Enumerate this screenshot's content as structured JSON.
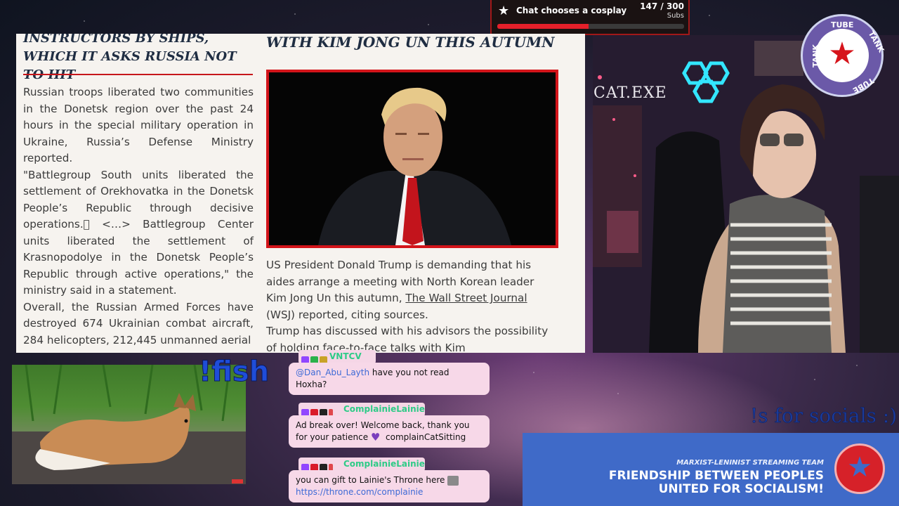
{
  "goal": {
    "title": "Chat chooses a cosplay",
    "count": "147 / 300",
    "unit": "Subs",
    "progress": 0.49,
    "accent": "#e4202a"
  },
  "article": {
    "left_headline": "INSTRUCTORS BY SHIPS, WHICH IT ASKS RUSSIA NOT TO HIT",
    "right_headline": "WITH KIM JONG UN THIS AUTUMN",
    "left_paragraphs": [
      "Russian troops liberated two communities in the Donetsk region over the past 24 hours in the special military operation in Ukraine, Russia’s Defense Ministry reported.",
      "\"Battlegroup South units liberated the settlement of Orekhovatka in the Donetsk People’s Republic through decisive operations.\u0000 <…> Battlegroup Center units liberated the settlement of Krasnopodolye in the Donetsk People’s Republic through active operations,\" the ministry said in a statement.",
      "Overall, the Russian Armed Forces have destroyed 674 Ukrainian combat aircraft, 284 helicopters, 212,445 unmanned aerial"
    ],
    "right_p1_a": "US President Donald Trump is demanding that his aides arrange a meeting with North Korean leader Kim Jong Un this autumn, ",
    "right_p1_link": "The Wall Street Journal",
    "right_p1_b": " (WSJ) reported, citing sources.",
    "right_p2": "Trump has discussed with his advisors the possibility of holding face-to-face talks with Kim",
    "accent": "#d3141a"
  },
  "webcam": {
    "overlay_text": "CAT.EXE"
  },
  "logo": {
    "ring_text": [
      "TUBE",
      "TANK",
      "TUBE",
      "TANK"
    ]
  },
  "fish": {
    "command": "!fish"
  },
  "chat": {
    "messages": [
      {
        "user": "VNTCV",
        "mention": "@Dan_Abu_Layth",
        "text": " have you not read Hoxha?"
      },
      {
        "user": "ComplainieLainie",
        "text": "Ad break over! Welcome back, thank you for your patience ",
        "emote": "complainCatSitting"
      },
      {
        "user": "ComplainieLainie",
        "text": "you can gift to Lainie's Throne here ",
        "link": "https://throne.com/complainie"
      }
    ]
  },
  "socials": "!s for socials :)",
  "banner": {
    "subtitle": "MARXIST-LENINIST STREAMING TEAM",
    "line1": "FRIENDSHIP BETWEEN PEOPLES",
    "line2": "UNITED FOR SOCIALISM!"
  }
}
